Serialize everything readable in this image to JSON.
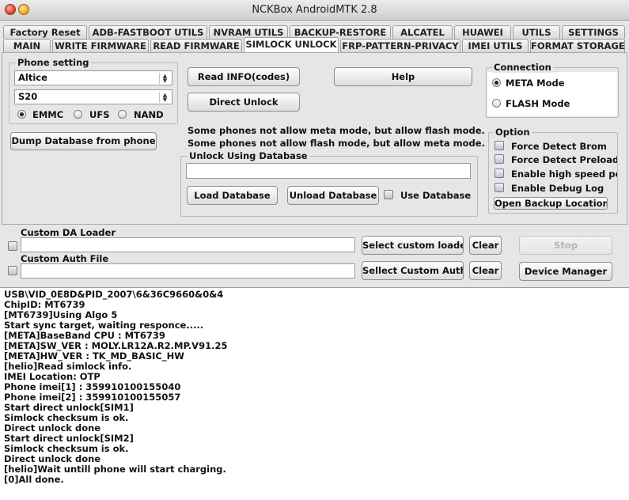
{
  "window": {
    "title": "NCKBox AndroidMTK 2.8"
  },
  "tabs_row1": [
    "Factory Reset",
    "ADB-FASTBOOT UTILS",
    "NVRAM UTILS",
    "BACKUP-RESTORE",
    "ALCATEL",
    "HUAWEI",
    "UTILS",
    "SETTINGS"
  ],
  "tabs_row2": [
    "MAIN",
    "WRITE FIRMWARE",
    "READ FIRMWARE",
    "SIMLOCK UNLOCK",
    "FRP-PATTERN-PRIVACY",
    "IMEI UTILS",
    "FORMAT STORAGE"
  ],
  "active_tab": "SIMLOCK UNLOCK",
  "phone_setting": {
    "label": "Phone setting",
    "brand": "Altice",
    "model": "S20",
    "storage_options": [
      "EMMC",
      "UFS",
      "NAND"
    ],
    "storage_selected": "EMMC"
  },
  "buttons": {
    "read_info": "Read INFO(codes)",
    "help": "Help",
    "direct_unlock": "Direct Unlock",
    "dump_database": "Dump Database from phone",
    "load_database": "Load Database",
    "unload_database": "Unload Database",
    "select_custom_loader": "Select custom loader",
    "clear1": "Clear",
    "stop": "Stop",
    "select_custom_auth": "Sellect Custom Auth",
    "clear2": "Clear",
    "device_manager": "Device Manager",
    "open_backup_location": "Open Backup Location"
  },
  "notes": {
    "line1": "Some phones not allow meta mode, but allow flash mode.",
    "line2": "Some phones not allow flash mode, but allow meta mode."
  },
  "unlock_db": {
    "label": "Unlock Using Database",
    "path_value": "",
    "use_database_label": "Use Database",
    "use_database_checked": false
  },
  "connection": {
    "label": "Connection",
    "options": [
      "META Mode",
      "FLASH Mode"
    ],
    "selected": "META Mode"
  },
  "option": {
    "label": "Option",
    "checks": [
      "Force Detect Brom",
      "Force Detect Preloader",
      "Enable high speed port",
      "Enable Debug Log"
    ]
  },
  "custom": {
    "da_label": "Custom DA Loader",
    "da_value": "",
    "auth_label": "Custom Auth File",
    "auth_value": ""
  },
  "log_lines": [
    "USB\\VID_0E8D&PID_2007\\6&36C9660&0&4",
    "ChipID: MT6739",
    "[MT6739]Using Algo 5",
    "Start sync target, waiting responce.....",
    "[META]BaseBand CPU : MT6739",
    "[META]SW_VER : MOLY.LR12A.R2.MP.V91.25",
    "[META]HW_VER : TK_MD_BASIC_HW",
    "[helio]Read simlock info.",
    "IMEI Location: OTP",
    "Phone imei[1] : 359910100155040",
    "Phone imei[2] : 359910100155057",
    "Start direct unlock[SIM1]",
    "Simlock checksum is ok.",
    "Direct unlock done",
    "Start direct unlock[SIM2]",
    "Simlock checksum is ok.",
    "Direct unlock done",
    "[helio]Wait untill phone will start charging.",
    "[0]All done."
  ]
}
